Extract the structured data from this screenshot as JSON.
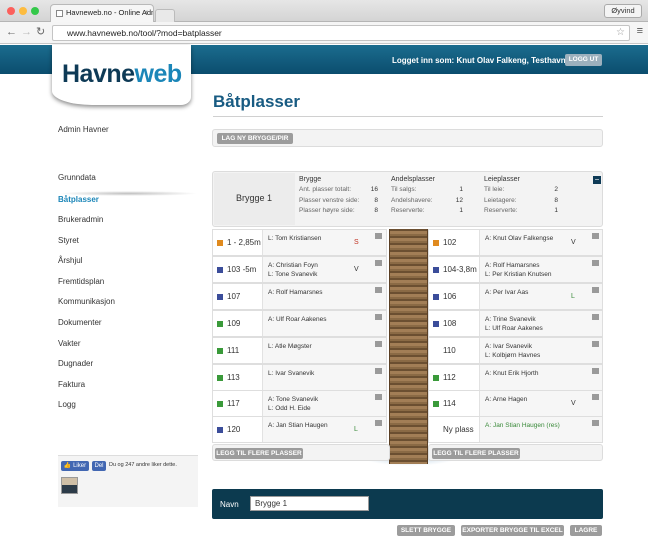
{
  "browser": {
    "tab_title": "Havneweb.no - Online Admi",
    "user": "Øyvind",
    "url": "www.havneweb.no/tool/?mod=batplasser"
  },
  "header": {
    "logo_part1": "Havne",
    "logo_part2": "web",
    "logged_in": "Logget inn som: Knut Olav Falkeng, Testhavn",
    "logout": "LOGG UT"
  },
  "sidebar": {
    "admin": "Admin Havner",
    "items": [
      "Grunndata",
      "Båtplasser",
      "Brukeradmin",
      "Styret",
      "Årshjul",
      "Fremtidsplan",
      "Kommunikasjon",
      "Dokumenter",
      "Vakter",
      "Dugnader",
      "Faktura",
      "Logg"
    ],
    "active": "Båtplasser"
  },
  "facebook": {
    "like": "Liker",
    "share": "Del",
    "text": "Du og 247 andre liker dette."
  },
  "main": {
    "title": "Båtplasser",
    "new_pier": "LAG NY BRYGGE/PIR"
  },
  "pier": {
    "name": "Brygge 1",
    "brygge": {
      "heading": "Brygge",
      "rows": [
        [
          "Ant. plasser totalt:",
          "16"
        ],
        [
          "Plasser venstre side:",
          "8"
        ],
        [
          "Plasser høyre side:",
          "8"
        ]
      ]
    },
    "andel": {
      "heading": "Andelsplasser",
      "rows": [
        [
          "Til salgs:",
          "1"
        ],
        [
          "Andelshavere:",
          "12"
        ],
        [
          "Reserverte:",
          "1"
        ]
      ]
    },
    "leie": {
      "heading": "Leieplasser",
      "rows": [
        [
          "Til leie:",
          "2"
        ],
        [
          "Leietagere:",
          "8"
        ],
        [
          "Reserverte:",
          "1"
        ]
      ]
    },
    "collapse": "−"
  },
  "berths_left": [
    {
      "num": "1 - 2,85m",
      "names": [
        "L: Tom Kristiansen"
      ],
      "status": "S",
      "color": "#e08a1e"
    },
    {
      "num": "103 -5m",
      "names": [
        "A: Christian Foyn",
        "L: Tone Svanevik"
      ],
      "status": "V",
      "color": "#3b4d9a"
    },
    {
      "num": "107",
      "names": [
        "A: Rolf Hamarsnes"
      ],
      "status": "",
      "color": "#3b4d9a"
    },
    {
      "num": "109",
      "names": [
        "A: Ulf Roar Aakenes"
      ],
      "status": "",
      "color": "#3a9a3a"
    },
    {
      "num": "111",
      "names": [
        "L: Atle Møgster"
      ],
      "status": "",
      "color": "#3a9a3a"
    },
    {
      "num": "113",
      "names": [
        "L: Ivar Svanevik"
      ],
      "status": "",
      "color": "#3a9a3a"
    },
    {
      "num": "117",
      "names": [
        "A: Tone Svanevik",
        "L: Odd H. Eide"
      ],
      "status": "",
      "color": "#3a9a3a"
    },
    {
      "num": "120",
      "names": [
        "A: Jan Stian Haugen"
      ],
      "status": "L",
      "color": "#3b4d9a"
    }
  ],
  "berths_right": [
    {
      "num": "102",
      "names": [
        "A: Knut Olav Falkengse"
      ],
      "status": "V",
      "color": "#e08a1e"
    },
    {
      "num": "104-3,8m",
      "names": [
        "A: Rolf Hamarsnes",
        "L: Per Kristian Knutsen"
      ],
      "status": "",
      "color": "#3b4d9a"
    },
    {
      "num": "106",
      "names": [
        "A: Per Ivar Aas"
      ],
      "status": "L",
      "color": "#3b4d9a"
    },
    {
      "num": "108",
      "names": [
        "A: Trine Svanevik",
        "L: Ulf Roar Aakenes"
      ],
      "status": "",
      "color": "#3b4d9a"
    },
    {
      "num": "110",
      "names": [
        "A: Ivar Svanevik",
        "L: Kolbjørn Havnes"
      ],
      "status": "",
      "color": ""
    },
    {
      "num": "112",
      "names": [
        "A: Knut Erik Hjorth"
      ],
      "status": "",
      "color": "#3a9a3a"
    },
    {
      "num": "114",
      "names": [
        "A: Arne Hagen"
      ],
      "status": "V",
      "color": "#3a9a3a"
    },
    {
      "num": "Ny plass",
      "names": [
        "A: Jan Stian Haugen (res)"
      ],
      "status": "",
      "color": ""
    }
  ],
  "add_more": "LEGG TIL FLERE PLASSER",
  "form": {
    "name_label": "Navn",
    "name_value": "Brygge 1"
  },
  "actions": {
    "delete": "SLETT BRYGGE",
    "export": "EXPORTER BRYGGE TIL EXCEL",
    "save": "LAGRE"
  }
}
